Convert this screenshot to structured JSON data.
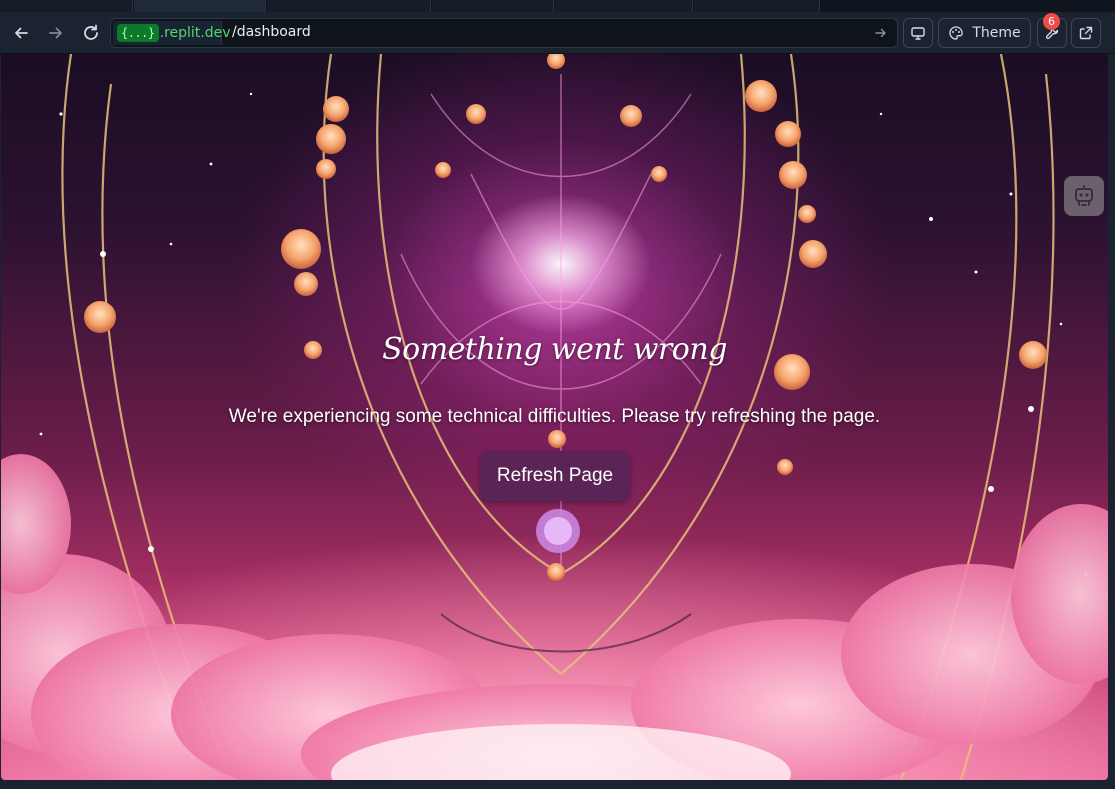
{
  "browser": {
    "url_domain_badge": "{...}",
    "url_domain": ".replit.dev",
    "url_path": "/dashboard",
    "theme_label": "Theme",
    "notification_count": "6"
  },
  "error_page": {
    "title": "Something went wrong",
    "message": "We're experiencing some technical difficulties. Please try refreshing the page.",
    "refresh_label": "Refresh Page"
  },
  "colors": {
    "toolbar_bg": "#1c2330",
    "domain_green": "#57d36d",
    "button_bg": "#5b2456",
    "badge_red": "#f04a4a"
  },
  "icons": {
    "back": "back-arrow-icon",
    "forward": "forward-arrow-icon",
    "reload": "reload-icon",
    "go": "go-arrow-icon",
    "device": "monitor-icon",
    "theme": "palette-icon",
    "tools": "wrench-icon",
    "external": "external-link-icon",
    "side": "robot-icon"
  }
}
